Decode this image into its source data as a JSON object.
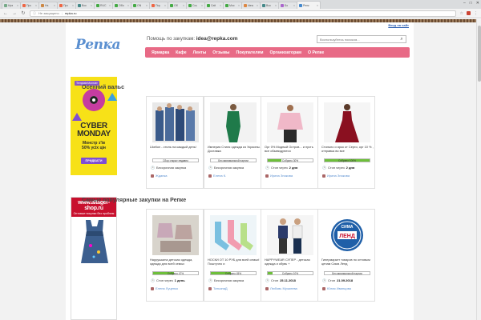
{
  "browser": {
    "tabs": [
      {
        "label": "Нрэ",
        "color": "#7a8"
      },
      {
        "label": "Про",
        "color": "#e64"
      },
      {
        "label": "Нэ.",
        "color": "#c84"
      },
      {
        "label": "Про",
        "color": "#e64"
      },
      {
        "label": "Вос",
        "color": "#488"
      },
      {
        "label": "RUC",
        "color": "#4a4"
      },
      {
        "label": "Обо",
        "color": "#4a4"
      },
      {
        "label": "ON",
        "color": "#4a4"
      },
      {
        "label": "Пор",
        "color": "#e64"
      },
      {
        "label": "Об",
        "color": "#4a4"
      },
      {
        "label": "Cou",
        "color": "#4a4"
      },
      {
        "label": "Catt",
        "color": "#4a4"
      },
      {
        "label": "Мос",
        "color": "#4a4"
      },
      {
        "label": "Idea",
        "color": "#d84"
      },
      {
        "label": "Вос",
        "color": "#488"
      },
      {
        "label": "Бо",
        "color": "#a6c"
      },
      {
        "label": "Репк",
        "color": "#48c",
        "active": true
      }
    ],
    "security_label": "Не защищено",
    "url": "repka.ru"
  },
  "header": {
    "login_link": "Вход на сайт",
    "logo": "Репка",
    "help_prefix": "Помощь по закупкам:",
    "help_email": "idea@repka.com",
    "search_placeholder": "Воспользуйтесь поиском..."
  },
  "menu": [
    "Ярмарка",
    "Кафе",
    "Ленты",
    "Отзывы",
    "Покупателям",
    "Организаторам",
    "О Репке"
  ],
  "ads": {
    "ad1": {
      "brand": "TemplateMonster",
      "headline_1": "CYBER",
      "headline_2": "MONDAY",
      "sub_1": "Монстр з'їв",
      "sub_2": "50% усіх цін",
      "button": "ПРИДБАТИ"
    },
    "ad2": {
      "headline": "www.altager-shop.ru",
      "sub": "Оптовые покупки без проблем"
    }
  },
  "sections": [
    {
      "title": "Осенний вальс",
      "cards": [
        {
          "title": "Likelion - стиль на каждый день!",
          "progress_label": "Сбор открыт недавно",
          "progress": 0,
          "meta_prefix": "",
          "meta_value": "Бессрочная закупка",
          "user": "Жданка",
          "image": "jeans-group-icon"
        },
        {
          "title": "Империя Стиля одежда из Украины. Доставка",
          "progress_label": "Без минимальной партии",
          "progress": 0,
          "meta_prefix": "",
          "meta_value": "Бессрочная закупка",
          "user": "Елена К.",
          "image": "green-dress-icon"
        },
        {
          "title": "Орг 0% Модный Остров... и пусть все обзавидуются",
          "progress_label": "Собрано 30%",
          "progress": 0.3,
          "meta_prefix": "Стоп через",
          "meta_value": "2 дня",
          "user": "Ирина Знакова",
          "image": "pink-sweater-icon"
        },
        {
          "title": "Стильно и ярко от Серги, орг 10 % , отправка во все",
          "progress_label": "Собрано 100%",
          "progress": 1.0,
          "meta_prefix": "Стоп через",
          "meta_value": "2 дня",
          "user": "Ирина Знакова",
          "image": "red-dress-icon"
        }
      ]
    },
    {
      "title": "Самые популярные закупки на Репке",
      "cards": [
        {
          "title": "Наррушкина детская одежда, одежда для всей семьи",
          "progress_label": "Собрано 47%",
          "progress": 0.47,
          "meta_prefix": "Стоп через",
          "meta_value": "1 день",
          "user": "Елена Луценко",
          "image": "baby-clothes-icon"
        },
        {
          "title": "НОСКИ ОТ 10 РУБ для всей семьи! Поштучно и",
          "progress_label": "Собрано 45%",
          "progress": 0.45,
          "meta_prefix": "",
          "meta_value": "Бессрочная закупка",
          "user": "ТатьянаД",
          "image": "socks-icon"
        },
        {
          "title": "HAPPYWEAR СУПЕР - детская одежда и обувь +",
          "progress_label": "Собрано 10%",
          "progress": 0.1,
          "meta_prefix": "Стоп",
          "meta_value": "25.11.2018",
          "user": "Любовь Музалева",
          "image": "kids-icon"
        },
        {
          "title": "Гипермаркет товаров по оптовым ценам Сима Ленд",
          "progress_label": "Без минимальной партии",
          "progress": 0,
          "meta_prefix": "Стоп",
          "meta_value": "21.09.2018",
          "user": "Юлия Иванцова",
          "image": "sima-land-logo-icon"
        }
      ]
    }
  ],
  "colors": {
    "menu_bg": "#e86a86",
    "logo": "#5a8fd0",
    "progress": "#6dbf3a"
  }
}
